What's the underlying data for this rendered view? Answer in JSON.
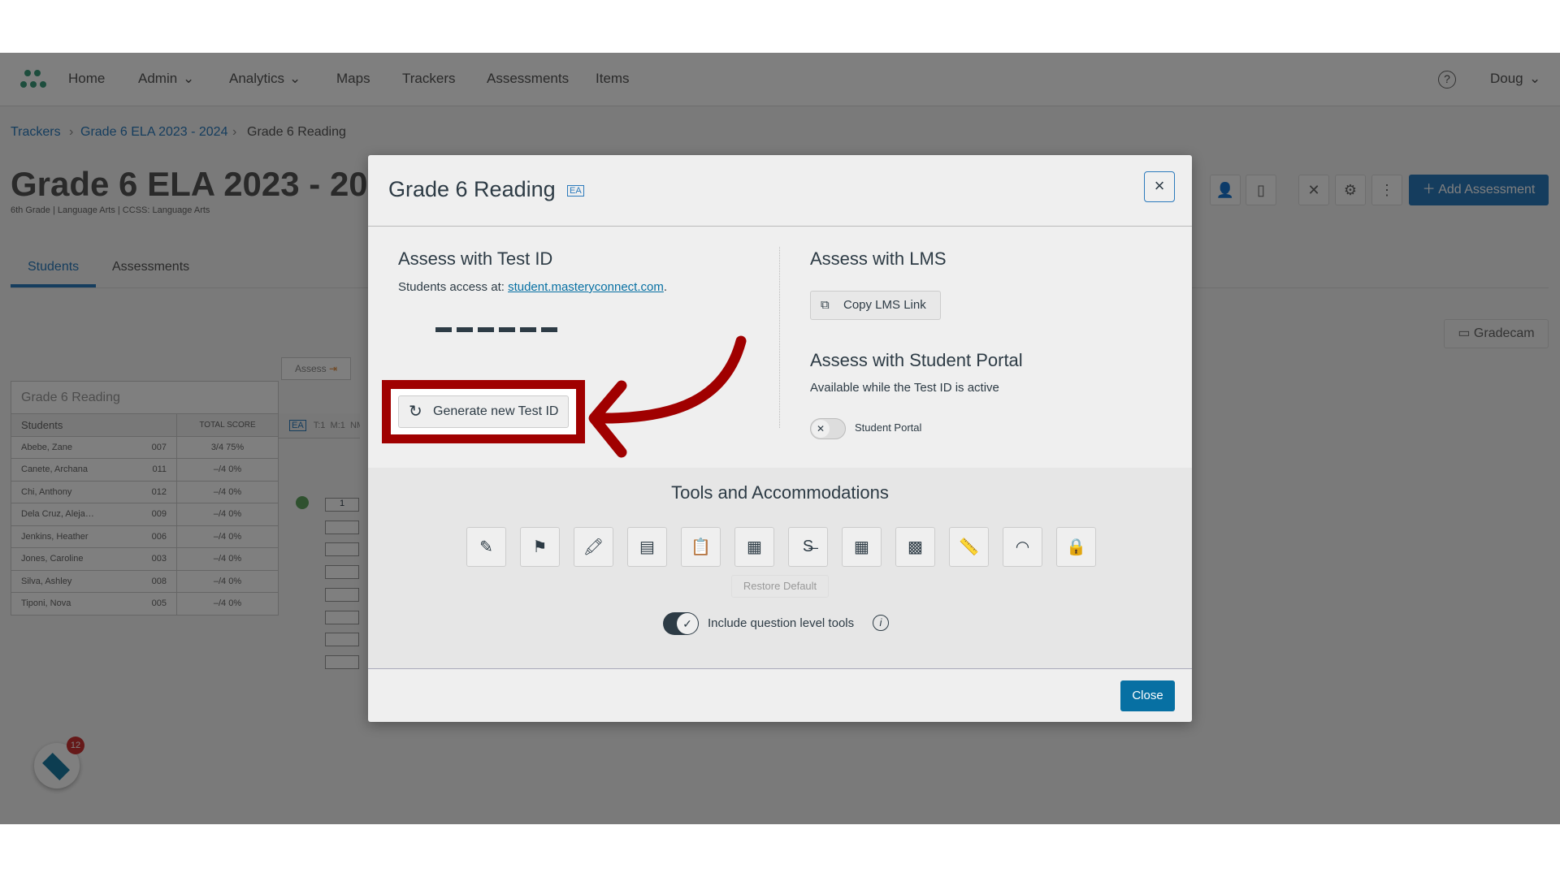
{
  "nav": {
    "items": [
      "Home",
      "Admin",
      "Analytics",
      "Maps",
      "Trackers",
      "Assessments",
      "Items"
    ],
    "user": "Doug"
  },
  "breadcrumb": [
    "Trackers",
    "Grade 6 ELA 2023 - 2024",
    "Grade 6 Reading"
  ],
  "page": {
    "title": "Grade 6 ELA 2023 - 2024",
    "subtitle": "6th Grade | Language Arts | CCSS: Language Arts",
    "tabs": [
      "Students",
      "Assessments"
    ],
    "add_assessment": "Add Assessment",
    "gradecam": "Gradecam",
    "assess": "Assess"
  },
  "table": {
    "title": "Grade 6 Reading",
    "col_students": "Students",
    "col_total": "TOTAL SCORE",
    "ea": "EA",
    "tm": "T:1  M:1  NM",
    "rows": [
      [
        "Abebe, Zane",
        "007",
        "3/4   75%",
        "1"
      ],
      [
        "Canete, Archana",
        "011",
        "–/4   0%",
        ""
      ],
      [
        "Chi, Anthony",
        "012",
        "–/4   0%",
        ""
      ],
      [
        "Dela Cruz, Aleja…",
        "009",
        "–/4   0%",
        ""
      ],
      [
        "Jenkins, Heather",
        "006",
        "–/4   0%",
        ""
      ],
      [
        "Jones, Caroline",
        "003",
        "–/4   0%",
        ""
      ],
      [
        "Silva, Ashley",
        "008",
        "–/4   0%",
        ""
      ],
      [
        "Tiponi, Nova",
        "005",
        "–/4   0%",
        ""
      ]
    ]
  },
  "modal": {
    "title": "Grade 6 Reading",
    "badge": "EA",
    "close_x": "×",
    "test_id": {
      "heading": "Assess with Test ID",
      "access_prefix": "Students access at: ",
      "access_link": "student.masteryconnect.com",
      "access_suffix": ".",
      "code": "------",
      "generate": "Generate new Test ID"
    },
    "lms": {
      "heading": "Assess with LMS",
      "copy": "Copy LMS Link"
    },
    "portal": {
      "heading": "Assess with Student Portal",
      "note": "Available while the Test ID is active",
      "toggle_label": "Student Portal",
      "enabled": false
    },
    "tools": {
      "heading": "Tools and Accommodations",
      "icons": [
        "annotate-icon",
        "flag-icon",
        "highlighter-icon",
        "line-reader-icon",
        "notepad-icon",
        "reference-sheet-icon",
        "strikethrough-icon",
        "calculator-icon",
        "scientific-calculator-icon",
        "ruler-icon",
        "protractor-icon",
        "lock-icon"
      ],
      "restore": "Restore Default",
      "include_label": "Include question level tools",
      "include_enabled": true
    },
    "close": "Close"
  },
  "launcher_badge": "12",
  "colors": {
    "highlight": "#a00000",
    "primary": "#0770a3"
  }
}
